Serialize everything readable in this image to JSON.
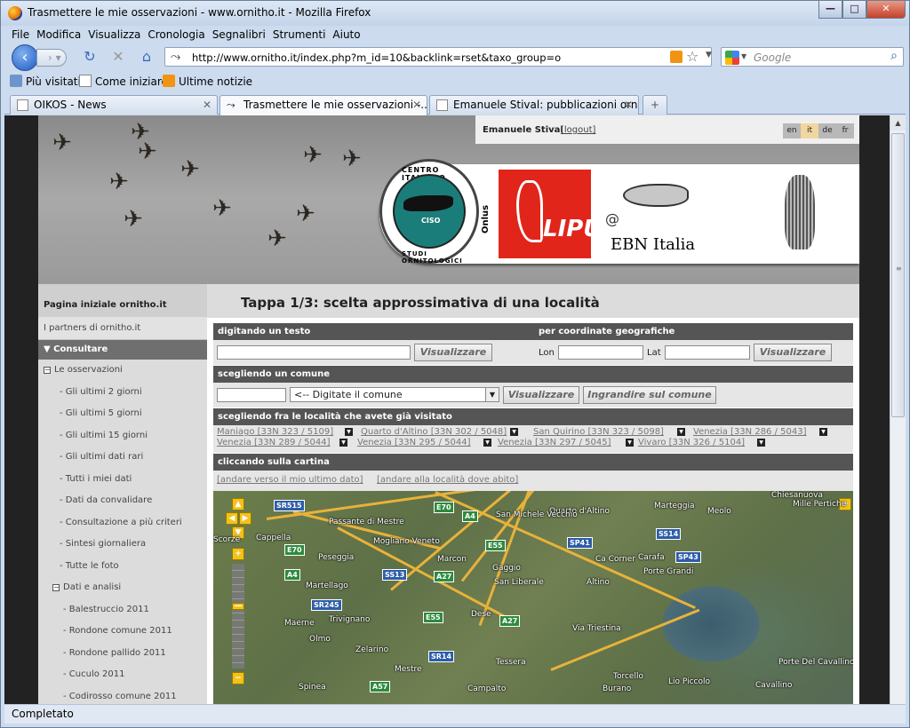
{
  "window": {
    "title": "Trasmettere le mie osservazioni - www.ornitho.it - Mozilla Firefox",
    "min": "—",
    "max": "□",
    "close": "✕"
  },
  "menu": [
    "File",
    "Modifica",
    "Visualizza",
    "Cronologia",
    "Segnalibri",
    "Strumenti",
    "Aiuto"
  ],
  "nav": {
    "url": "http://www.ornitho.it/index.php?m_id=10&backlink=rset&taxo_group=o",
    "search_placeholder": "Google"
  },
  "bookmarks": [
    "Più visitati",
    "Come iniziare",
    "Ultime notizie"
  ],
  "tabs": [
    {
      "label": "OIKOS - News"
    },
    {
      "label": "Trasmettere le mie osservazioni -..."
    },
    {
      "label": "Emanuele Stival: pubblicazioni ornit..."
    }
  ],
  "newtab": "+",
  "status": "Completato",
  "page": {
    "user": "Emanuele Stival",
    "logout": "[logout]",
    "langs": [
      "en",
      "it",
      "de",
      "fr"
    ],
    "logos": {
      "ciso_top": "CENTRO ITALIANO",
      "ciso_bottom": "STUDI ORNITOLOGICI",
      "ciso_mark": "CISO",
      "onlus": "Onlus",
      "lipu": "LIPU",
      "ebn_at": "@",
      "ebn": "EBN Italia"
    },
    "sidebar": {
      "home": "Pagina iniziale ornitho.it",
      "partners": "I partners di ornitho.it",
      "consult": "▼ Consultare",
      "items": [
        {
          "label": "Le osservazioni",
          "indent": 6,
          "box": "−"
        },
        {
          "label": "- Gli ultimi 2 giorni",
          "indent": 24
        },
        {
          "label": "- Gli ultimi 5 giorni",
          "indent": 24
        },
        {
          "label": "- Gli ultimi 15 giorni",
          "indent": 24
        },
        {
          "label": "- Gli ultimi dati rari",
          "indent": 24
        },
        {
          "label": "- Tutti i miei dati",
          "indent": 24
        },
        {
          "label": "- Dati da convalidare",
          "indent": 24
        },
        {
          "label": "- Consultazione a più criteri",
          "indent": 24
        },
        {
          "label": "- Sintesi giornaliera",
          "indent": 24
        },
        {
          "label": "- Tutte le foto",
          "indent": 24
        },
        {
          "label": "Dati e analisi",
          "indent": 16,
          "box": "−"
        },
        {
          "label": "- Balestruccio 2011",
          "indent": 28
        },
        {
          "label": "- Rondone comune 2011",
          "indent": 28
        },
        {
          "label": "- Rondone pallido 2011",
          "indent": 28
        },
        {
          "label": "- Cuculo 2011",
          "indent": 28
        },
        {
          "label": "- Codirosso comune 2011",
          "indent": 28
        }
      ]
    },
    "step_title": "Tappa 1/3: scelta approssimativa di una località",
    "sec_text": "digitando un testo",
    "sec_coords": "per coordinate geografiche",
    "btn_view": "Visualizzare",
    "lon": "Lon",
    "lat": "Lat",
    "sec_comune": "scegliendo un comune",
    "comune_select": "<-- Digitate il comune",
    "btn_zoom": "Ingrandire sul comune",
    "sec_visited": "scegliendo fra le località che avete già visitato",
    "visited": [
      "Maniago [33N 323 / 5109]",
      "Quarto d'Altino [33N 302 / 5048]",
      "San Quirino [33N 323 / 5098]",
      "Venezia [33N 286 / 5043]",
      "Venezia [33N 289 / 5044]",
      "Venezia [33N 295 / 5044]",
      "Venezia [33N 297 / 5045]",
      "Vivaro [33N 326 / 5104]"
    ],
    "sec_map": "cliccando sulla cartina",
    "map_links": [
      "[andare verso il mio ultimo dato]",
      "[andare alla località dove abito]"
    ],
    "map": {
      "places": [
        "Mogliano Veneto",
        "Marcon",
        "Martellago",
        "Quarto d'Altino",
        "San Michele Vecchio",
        "Marteggia",
        "Meolo",
        "Chiesanuova",
        "Mille Pertiche",
        "Carafa",
        "Porte Grandi",
        "Gaggio",
        "San Liberale",
        "Altino",
        "Peseggia",
        "Cappella",
        "Scorzè",
        "Maerne",
        "Trivignano",
        "Olmo",
        "Zelarino",
        "Dese",
        "Mestre",
        "Tessera",
        "Campalto",
        "Spinea",
        "Torcello",
        "Burano",
        "Lio Piccolo",
        "Cavallino",
        "Porte Del Cavallino",
        "Ca Corner",
        "Via Triestina",
        "Passante di Mestre"
      ],
      "shields": [
        "SR515",
        "E70",
        "A4",
        "E55",
        "SP41",
        "SS14",
        "SP43",
        "SS13",
        "A27",
        "E70",
        "A4",
        "SR245",
        "E55",
        "A27",
        "SR14",
        "A57"
      ]
    }
  }
}
